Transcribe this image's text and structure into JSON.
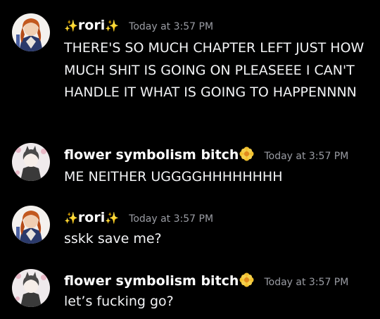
{
  "messages": [
    {
      "author": "rori",
      "author_prefix": "✨",
      "author_suffix": "✨",
      "timestamp": "Today at 3:57 PM",
      "content": "THERE'S SO MUCH CHAPTER LEFT JUST HOW MUCH SHIT IS GOING ON PLEASEEE I CAN'T HANDLE IT WHAT IS GOING TO HAPPENNNN"
    },
    {
      "author": "flower symbolism bitch",
      "badge_icon": "yellow-flower-icon",
      "timestamp": "Today at 3:57 PM",
      "content": "ME NEITHER UGGGGHHHHHHHH"
    },
    {
      "author": "rori",
      "author_prefix": "✨",
      "author_suffix": "✨",
      "timestamp": "Today at 3:57 PM",
      "content": "sskk save me?"
    },
    {
      "author": "flower symbolism bitch",
      "badge_icon": "yellow-flower-icon",
      "timestamp": "Today at 3:57 PM",
      "content": "let’s fucking go?"
    }
  ],
  "colors": {
    "background": "#000000",
    "username": "#ffffff",
    "timestamp": "#9a9ca3",
    "message_text": "#f2f3f5",
    "sparkle": "#f5c542",
    "flower_badge": "#f2c12e"
  }
}
